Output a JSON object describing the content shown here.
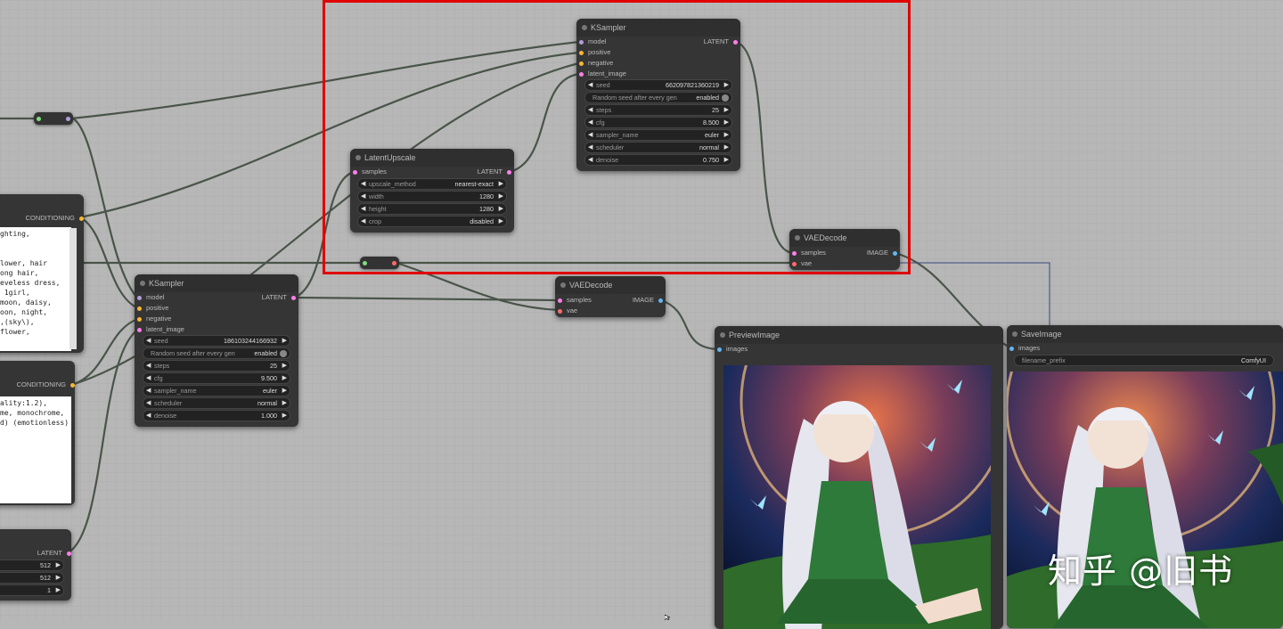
{
  "colors": {
    "model_pin": "#b39ddb",
    "cond_pin": "#f7b731",
    "latent_pin": "#ff7eeb",
    "image_pin": "#64b5f6",
    "vae_pin": "#ff6b6b",
    "highlight": "#e00000"
  },
  "nodes": {
    "ksampler_top": {
      "title": "KSampler",
      "inputs": [
        "model",
        "positive",
        "negative",
        "latent_image"
      ],
      "output": "LATENT",
      "seed_label": "seed",
      "seed_value": "662097821360219",
      "random_seed_label": "Random seed after every gen",
      "random_seed_value": "enabled",
      "steps_label": "steps",
      "steps_value": "25",
      "cfg_label": "cfg",
      "cfg_value": "8.500",
      "sampler_label": "sampler_name",
      "sampler_value": "euler",
      "scheduler_label": "scheduler",
      "scheduler_value": "normal",
      "denoise_label": "denoise",
      "denoise_value": "0.750"
    },
    "latent_upscale": {
      "title": "LatentUpscale",
      "input": "samples",
      "output": "LATENT",
      "method_label": "upscale_method",
      "method_value": "nearest-exact",
      "width_label": "width",
      "width_value": "1280",
      "height_label": "height",
      "height_value": "1280",
      "crop_label": "crop",
      "crop_value": "disabled"
    },
    "vae_decode_top": {
      "title": "VAEDecode",
      "inputs": [
        "samples",
        "vae"
      ],
      "output": "IMAGE"
    },
    "ksampler_left": {
      "title": "KSampler",
      "inputs": [
        "model",
        "positive",
        "negative",
        "latent_image"
      ],
      "output": "LATENT",
      "seed_label": "seed",
      "seed_value": "186103244166932",
      "random_seed_label": "Random seed after every gen",
      "random_seed_value": "enabled",
      "steps_label": "steps",
      "steps_value": "25",
      "cfg_label": "cfg",
      "cfg_value": "9.500",
      "sampler_label": "sampler_name",
      "sampler_value": "euler",
      "scheduler_label": "scheduler",
      "scheduler_value": "normal",
      "denoise_label": "denoise",
      "denoise_value": "1.000"
    },
    "vae_decode_mid": {
      "title": "VAEDecode",
      "inputs": [
        "samples",
        "vae"
      ],
      "output": "IMAGE"
    },
    "preview_image": {
      "title": "PreviewImage",
      "input": "images"
    },
    "save_image": {
      "title": "SaveImage",
      "input": "images",
      "prefix_label": "filename_prefix",
      "prefix_value": "ComfyUI"
    },
    "positive_prompt": {
      "output": "CONDITIONING",
      "text": "ghting,\n\n\nlower, hair\nong hair,\neveless dress,\n 1girl,\nmoon, daisy,\noon, night,\n,(sky\\),\nflower,"
    },
    "negative_prompt": {
      "output": "CONDITIONING",
      "text": "ality:1.2),\nme, monochrome,\nd) (emotionless)"
    },
    "empty_latent": {
      "output": "LATENT",
      "values": [
        "512",
        "512",
        "1"
      ]
    }
  },
  "watermark": "知乎 @旧书"
}
